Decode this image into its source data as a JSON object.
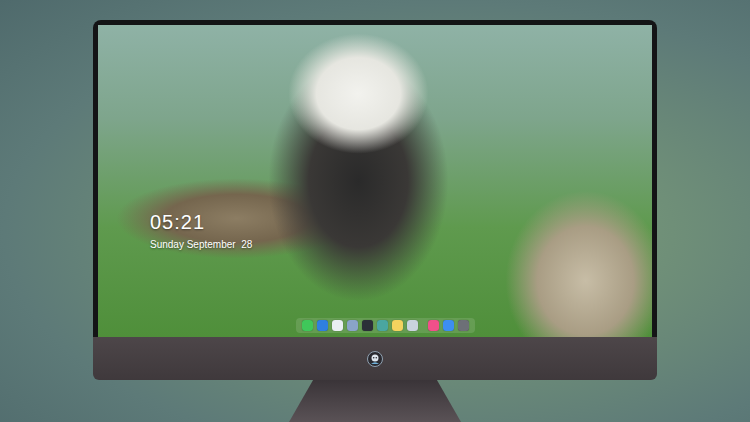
{
  "screen": {
    "wallpaper": "photo"
  },
  "lock_screen": {
    "time": "05:21",
    "date": "Sunday September  28"
  },
  "dock": {
    "apps": [
      {
        "color": "#3fc75a"
      },
      {
        "color": "#2f7fe0"
      },
      {
        "color": "#e9eef3"
      },
      {
        "color": "#8aa4c8"
      },
      {
        "color": "#2b2f38"
      },
      {
        "color": "#4aa6a0"
      },
      {
        "color": "#f4d35e"
      },
      {
        "color": "#c9d3de"
      }
    ],
    "extras": [
      {
        "color": "#f0508a"
      },
      {
        "color": "#3d8ef0"
      },
      {
        "color": "#6d7077"
      }
    ]
  }
}
